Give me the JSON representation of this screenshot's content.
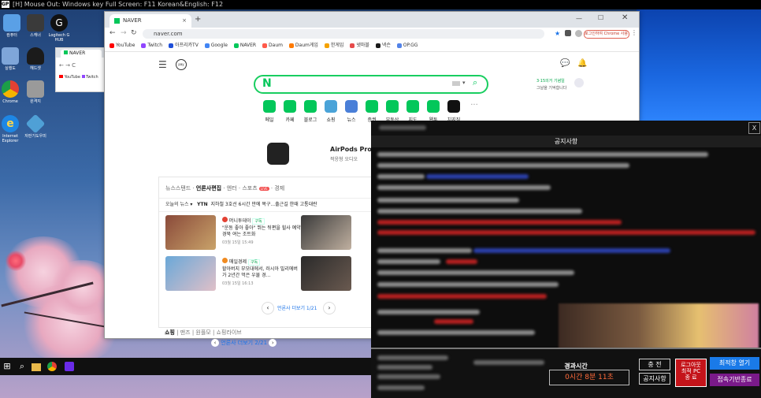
{
  "remote_bar": {
    "text": "[H] Mouse Out: Windows key     Full Screen: F11     Korean&English: F12",
    "logo": "GPB"
  },
  "desktop": {
    "icons": [
      {
        "label": "컴퓨터",
        "name": "computer-icon",
        "color": "#5aa0e6"
      },
      {
        "label": "스캐너",
        "name": "scanner-icon",
        "color": "#3a3a3a"
      },
      {
        "label": "Logitech G HUB",
        "name": "logitech-ghub-icon",
        "color": "#111111"
      },
      {
        "label": "실행도",
        "name": "run-icon",
        "color": "#7fa6d9"
      },
      {
        "label": "헤드셋",
        "name": "headset-icon",
        "color": "#1b1b1b"
      },
      {
        "label": "Chrome",
        "name": "chrome-icon",
        "color": "#e34133"
      },
      {
        "label": "원격지",
        "name": "remote-icon",
        "color": "#9a9a9a"
      },
      {
        "label": "Internet Explorer",
        "name": "internet-explorer-icon",
        "color": "#1e87e4"
      },
      {
        "label": "자판기도우미",
        "name": "utility-icon",
        "color": "#4fa0d6"
      }
    ]
  },
  "browser_back": {
    "tab_title": "NAVER",
    "bookmark_youtube": "YouTube",
    "bookmark_twitch": "Twitch"
  },
  "browser": {
    "tab_title": "NAVER",
    "new_tab": "+",
    "url": "naver.com",
    "signin_label": "로그인하여 Chrome 사용 가능",
    "bookmarks": [
      {
        "label": "YouTube",
        "color": "#ff0000"
      },
      {
        "label": "Twitch",
        "color": "#9146ff"
      },
      {
        "label": "아프리카TV",
        "color": "#1e4fd8"
      },
      {
        "label": "Google",
        "color": "#4285f4"
      },
      {
        "label": "NAVER",
        "color": "#03c75a"
      },
      {
        "label": "Daum",
        "color": "#ff5a4a"
      },
      {
        "label": "Daum게임",
        "color": "#ff7a00"
      },
      {
        "label": "한게임",
        "color": "#f5a200"
      },
      {
        "label": "넷마블",
        "color": "#e64b4b"
      },
      {
        "label": "넥슨",
        "color": "#1a1a1a"
      },
      {
        "label": "OP.GG",
        "color": "#5383e8"
      }
    ]
  },
  "naver": {
    "logo": "N",
    "pay": "pay",
    "weather_line1": "3·15의거 기념일",
    "weather_line2": "그날을 기억합니다",
    "services": [
      "메일",
      "카페",
      "블로그",
      "쇼핑",
      "뉴스",
      "증권",
      "부동산",
      "지도",
      "웹툰",
      "치지직",
      "더보기"
    ],
    "ad_title": "AirPods Pro",
    "ad_subtitle": "적응형 오디오",
    "news_tabs": [
      "뉴스스탠드",
      "언론사편집",
      "엔터",
      "스포츠",
      "LIVE",
      "경제"
    ],
    "ticker_label": "오늘의 뉴스",
    "ticker_source": "YTN",
    "ticker_text": "지하철 3호선 6시간 만에 복구...출근길 한때 고통대란",
    "articles": [
      {
        "press": "머니투데이",
        "subscribe": "구독",
        "title": "\"운동 좋아 좋아\" 뛰는 뒤편을 힐사 예약 경북 여는 조트화",
        "date": "03월 15일 15:49"
      },
      {
        "press": "매일경제",
        "subscribe": "구독",
        "title": "할아버지 부모대에서, 러시아 빌리에버가 2년간 먹은 우물 경...",
        "date": "03월 15일 16:13"
      }
    ],
    "pager_text": "언론사 더보기 1/21",
    "shopping_tabs": [
      "쇼핑",
      "맨즈",
      "원플모",
      "쇼핑라이브"
    ],
    "pager2_text": "언론사 더보기 2/21"
  },
  "notice": {
    "close": "X",
    "title": "공지사항",
    "usage_label": "경과시간",
    "usage_value": "0시간 8분 11초",
    "buttons": {
      "charge": "충 전",
      "notice": "공지사항",
      "logout": "로그아웃\n최적 PC\n종 료",
      "seat": "최적창 열기",
      "end": "접속기반종료"
    }
  }
}
